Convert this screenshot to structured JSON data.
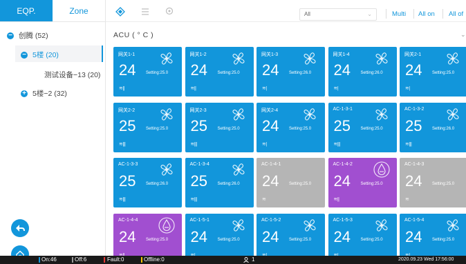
{
  "left_tabs": [
    "EQP.",
    "Zone"
  ],
  "tree": [
    {
      "icon": "−",
      "label": "创腾 (52)"
    },
    {
      "icon": "−",
      "label": "5楼 (20)"
    },
    {
      "label": "测试设备−13 (20)"
    },
    {
      "icon": "+",
      "label": "5楼−2 (32)"
    }
  ],
  "toolbar": {
    "filter_value": "All",
    "buttons": [
      "Multi",
      "All on",
      "All of"
    ]
  },
  "section_title": "ACU ( ° C )",
  "setting_prefix": "Setting:",
  "cards": [
    {
      "name": "网关1-1",
      "temp": "24",
      "setting": "25.0",
      "fan": "≋||",
      "mode": "fan",
      "state": "on"
    },
    {
      "name": "网关1-2",
      "temp": "24",
      "setting": "25.0",
      "fan": "≋||",
      "mode": "fan",
      "state": "on"
    },
    {
      "name": "网关1-3",
      "temp": "24",
      "setting": "26.0",
      "fan": "≋|",
      "mode": "fan",
      "state": "on"
    },
    {
      "name": "网关1-4",
      "temp": "24",
      "setting": "26.0",
      "fan": "≋|",
      "mode": "fan",
      "state": "on"
    },
    {
      "name": "网关2-1",
      "temp": "24",
      "setting": "25.0",
      "fan": "≋|",
      "mode": "fan",
      "state": "on"
    },
    {
      "name": "网关2-2",
      "temp": "25",
      "setting": "25.0",
      "fan": "≋|||",
      "mode": "fan",
      "state": "on"
    },
    {
      "name": "网关2-3",
      "temp": "25",
      "setting": "25.0",
      "fan": "≋|||",
      "mode": "fan",
      "state": "on"
    },
    {
      "name": "网关2-4",
      "temp": "24",
      "setting": "25.0",
      "fan": "≋|",
      "mode": "fan",
      "state": "on"
    },
    {
      "name": "AC-1-3-1",
      "temp": "25",
      "setting": "25.0",
      "fan": "≋|||",
      "mode": "fan",
      "state": "on"
    },
    {
      "name": "AC-1-3-2",
      "temp": "25",
      "setting": "26.0",
      "fan": "≋|||",
      "mode": "fan",
      "state": "on"
    },
    {
      "name": "AC-1-3-3",
      "temp": "25",
      "setting": "26.0",
      "fan": "≋|||",
      "mode": "fan",
      "state": "on"
    },
    {
      "name": "AC-1-3-4",
      "temp": "25",
      "setting": "26.0",
      "fan": "≋|||",
      "mode": "fan",
      "state": "on"
    },
    {
      "name": "AC-1-4-1",
      "temp": "24",
      "setting": "25.0",
      "fan": "≋",
      "mode": "none",
      "state": "off"
    },
    {
      "name": "AC-1-4-2",
      "temp": "24",
      "setting": "25.0",
      "fan": "≋||",
      "mode": "dry",
      "state": "dry"
    },
    {
      "name": "AC-1-4-3",
      "temp": "24",
      "setting": "25.0",
      "fan": "≋",
      "mode": "none",
      "state": "off"
    },
    {
      "name": "AC-1-4-4",
      "temp": "24",
      "setting": "25.0",
      "fan": "≋||",
      "mode": "dry",
      "state": "dry"
    },
    {
      "name": "AC-1-5-1",
      "temp": "24",
      "setting": "25.0",
      "fan": "≋|",
      "mode": "fan",
      "state": "on"
    },
    {
      "name": "AC-1-5-2",
      "temp": "24",
      "setting": "25.0",
      "fan": "≋|",
      "mode": "fan",
      "state": "on"
    },
    {
      "name": "AC-1-5-3",
      "temp": "24",
      "setting": "25.0",
      "fan": "≋|",
      "mode": "fan",
      "state": "on"
    },
    {
      "name": "AC-1-5-4",
      "temp": "24",
      "setting": "25.0",
      "fan": "≋|",
      "mode": "fan",
      "state": "on"
    }
  ],
  "colors": {
    "on": "#1296db",
    "off": "#b5b5b5",
    "dry": "#a14fd0",
    "accent": "#1296db",
    "status_on": "#1296db",
    "status_off": "#9a9a9a",
    "status_fault": "#e53935",
    "status_offline": "#f5c400"
  },
  "status": {
    "on": "On:46",
    "off": "Off:6",
    "fault": "Fault:0",
    "offline": "Offline:0",
    "user_count": "1",
    "datetime": "2020.09.23   Wed   17:56:00"
  }
}
